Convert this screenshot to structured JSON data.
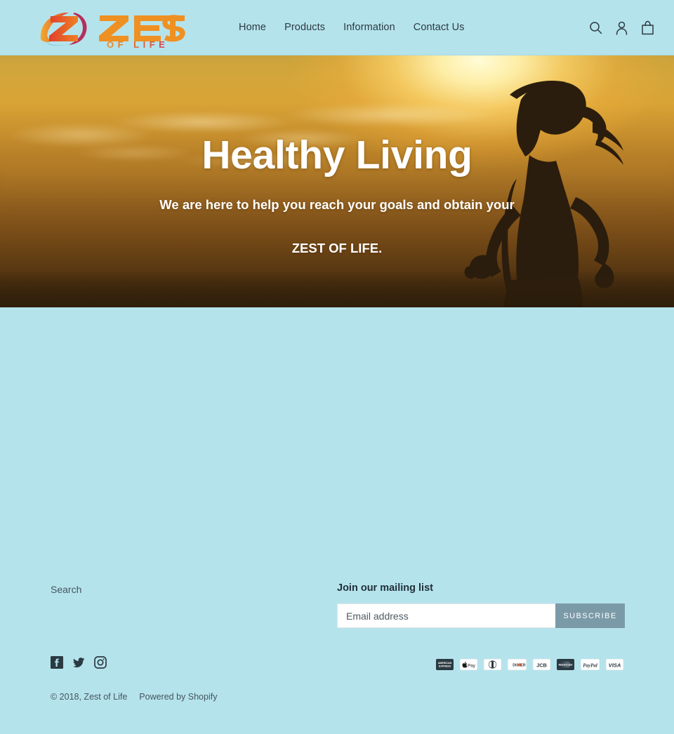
{
  "site": {
    "brand_name": "ZEST",
    "brand_tagline": "OF LIFE",
    "background_color": "#b5e3ec",
    "accent_color": "#e8622a"
  },
  "header": {
    "logo_name": "zest-of-life-logo",
    "nav": [
      {
        "label": "Home"
      },
      {
        "label": "Products"
      },
      {
        "label": "Information"
      },
      {
        "label": "Contact Us"
      }
    ],
    "icons": [
      {
        "name": "search-icon",
        "label": "Search"
      },
      {
        "name": "account-icon",
        "label": "Log in"
      },
      {
        "name": "cart-icon",
        "label": "Cart"
      }
    ]
  },
  "hero": {
    "image_name": "sunset-runner-silhouette",
    "heading": "Healthy Living",
    "subheading_line1": "We are here to help you reach your goals and obtain your",
    "subheading_line2": "ZEST OF LIFE."
  },
  "footer": {
    "links": [
      {
        "label": "Search"
      }
    ],
    "newsletter": {
      "heading": "Join our mailing list",
      "placeholder": "Email address",
      "value": "",
      "button_label": "SUBSCRIBE",
      "button_color": "#7b9aa8"
    },
    "social": [
      {
        "name": "facebook-icon",
        "label": "Facebook"
      },
      {
        "name": "twitter-icon",
        "label": "Twitter"
      },
      {
        "name": "instagram-icon",
        "label": "Instagram"
      }
    ],
    "payment_methods": [
      {
        "name": "american-express-icon",
        "label": "American Express"
      },
      {
        "name": "apple-pay-icon",
        "label": "Apple Pay"
      },
      {
        "name": "diners-club-icon",
        "label": "Diners Club"
      },
      {
        "name": "discover-icon",
        "label": "Discover"
      },
      {
        "name": "jcb-icon",
        "label": "JCB"
      },
      {
        "name": "master-icon",
        "label": "Master"
      },
      {
        "name": "paypal-icon",
        "label": "PayPal"
      },
      {
        "name": "visa-icon",
        "label": "Visa"
      }
    ],
    "copyright": "© 2018, Zest of Life",
    "powered_by": "Powered by Shopify"
  }
}
